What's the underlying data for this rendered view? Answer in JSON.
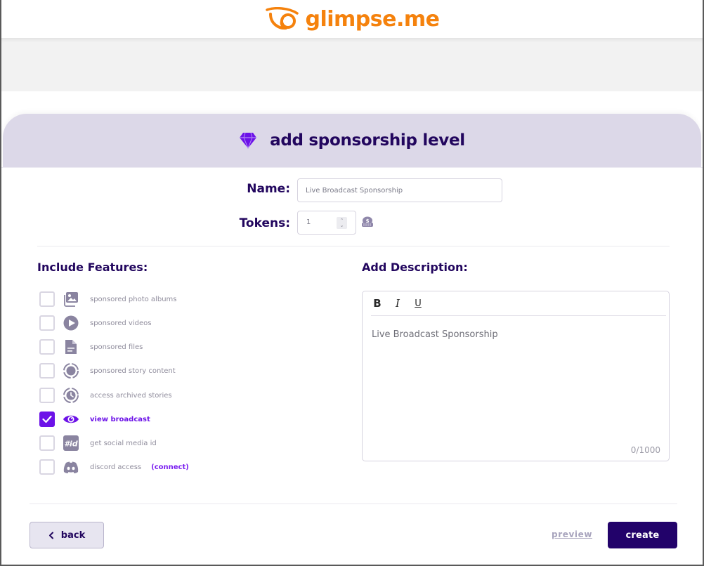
{
  "brand": {
    "name": "glimpse.me",
    "color": "#f5820d"
  },
  "header": {
    "title": "add sponsorship level",
    "icon": "diamond-icon"
  },
  "form": {
    "name_label": "Name:",
    "name_value": "Live Broadcast Sponsorship",
    "tokens_label": "Tokens:",
    "tokens_value": "1",
    "tokens_icon": "coin-stack-icon"
  },
  "features": {
    "title": "Include Features:",
    "items": [
      {
        "label": "sponsored photo albums",
        "icon": "photo-album-icon",
        "checked": false
      },
      {
        "label": "sponsored videos",
        "icon": "play-circle-icon",
        "checked": false
      },
      {
        "label": "sponsored files",
        "icon": "file-icon",
        "checked": false
      },
      {
        "label": "sponsored story content",
        "icon": "story-ring-icon",
        "checked": false
      },
      {
        "label": "access archived stories",
        "icon": "archived-story-icon",
        "checked": false
      },
      {
        "label": "view broadcast",
        "icon": "eye-icon",
        "checked": true
      },
      {
        "label": "get social media id",
        "icon": "hashtag-id-icon",
        "checked": false
      },
      {
        "label": "discord access",
        "icon": "discord-icon",
        "checked": false,
        "link": "(connect)"
      }
    ]
  },
  "description": {
    "title": "Add Description:",
    "toolbar": {
      "bold": "B",
      "italic": "I",
      "underline": "U"
    },
    "content": "Live Broadcast Sponsorship",
    "char_count": "0/1000"
  },
  "footer": {
    "back_label": "back",
    "preview_label": "preview",
    "create_label": "create"
  },
  "colors": {
    "primary": "#22065e",
    "accent": "#6c12e8",
    "header_bg": "#dcd8e8",
    "create_bg": "#22026a"
  }
}
